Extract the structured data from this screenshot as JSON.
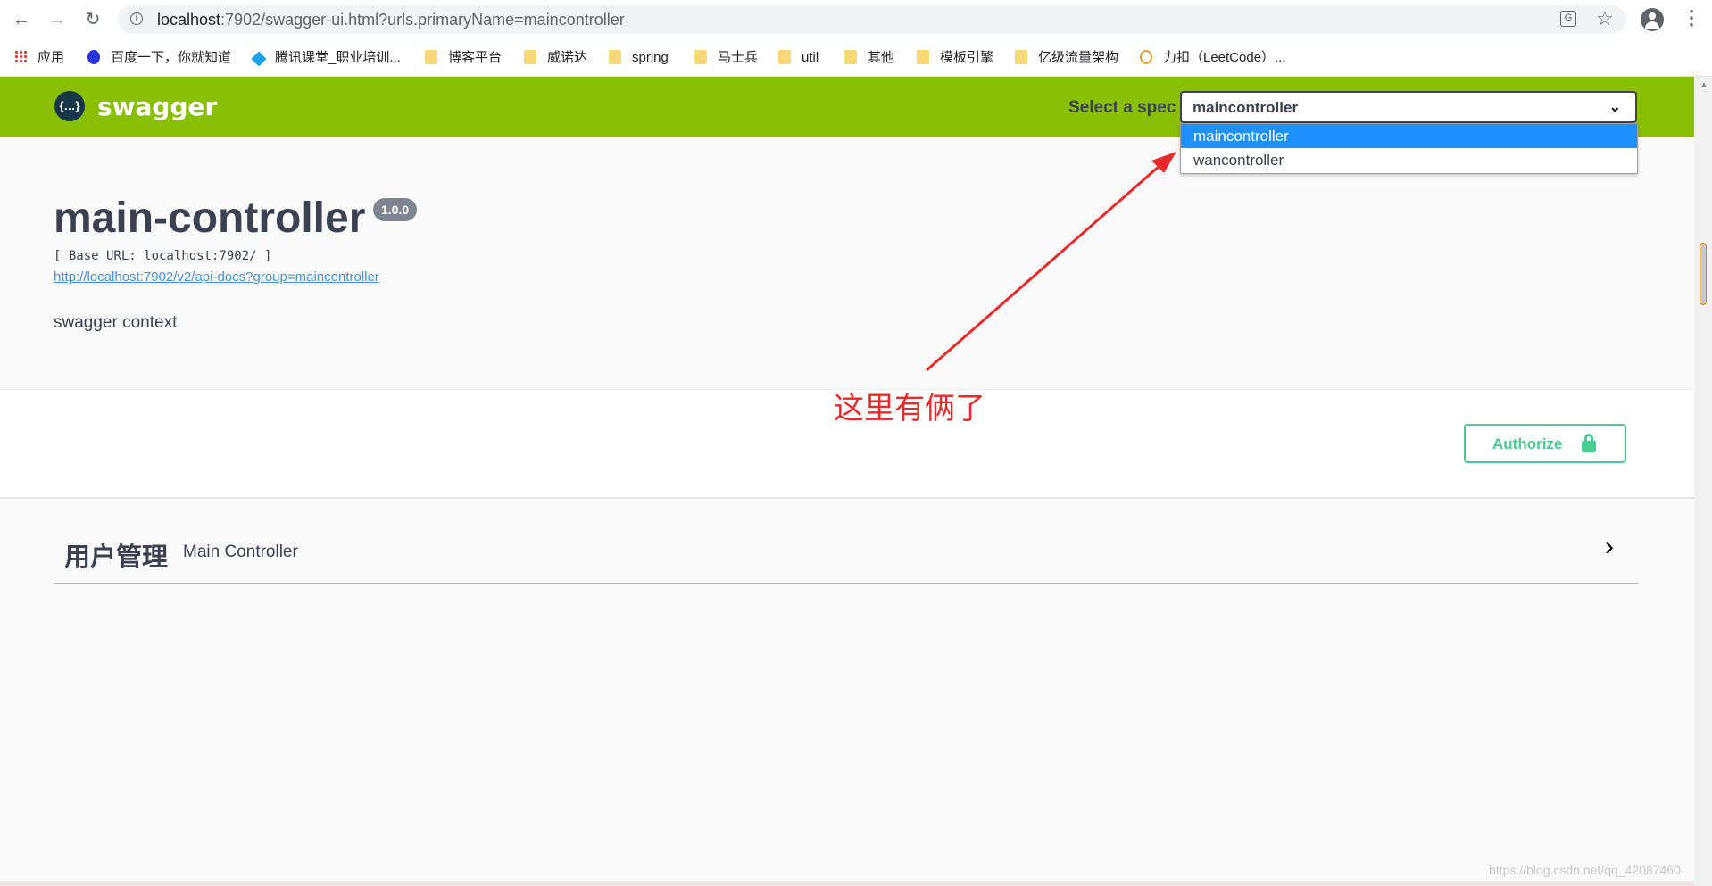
{
  "browser": {
    "url_host": "localhost",
    "url_rest": ":7902/swagger-ui.html?urls.primaryName=maincontroller",
    "bookmarks": [
      "应用",
      "百度一下，你就知道",
      "腾讯课堂_职业培训...",
      "博客平台",
      "威诺达",
      "spring",
      "马士兵",
      "util",
      "其他",
      "模板引擎",
      "亿级流量架构",
      "力扣（LeetCode）..."
    ]
  },
  "header": {
    "logo_text": "{…}",
    "title": "swagger",
    "spec_label": "Select a spec",
    "spec_value": "maincontroller",
    "options": [
      "maincontroller",
      "wancontroller"
    ]
  },
  "info": {
    "title": "main-controller",
    "version": "1.0.0",
    "base_url": "[ Base URL: localhost:7902/ ]",
    "docs_link": "http://localhost:7902/v2/api-docs?group=maincontroller",
    "description": "swagger context"
  },
  "authorize": {
    "label": "Authorize"
  },
  "tag": {
    "name": "用户管理",
    "description": "Main Controller"
  },
  "annotation": {
    "text": "这里有俩了"
  },
  "watermark": "https://blog.csdn.net/qq_42087460",
  "colors": {
    "header_bg": "#89bf04",
    "selected_option": "#1e90ff",
    "authorize": "#49cc90",
    "annotation": "#ea2a2a"
  }
}
